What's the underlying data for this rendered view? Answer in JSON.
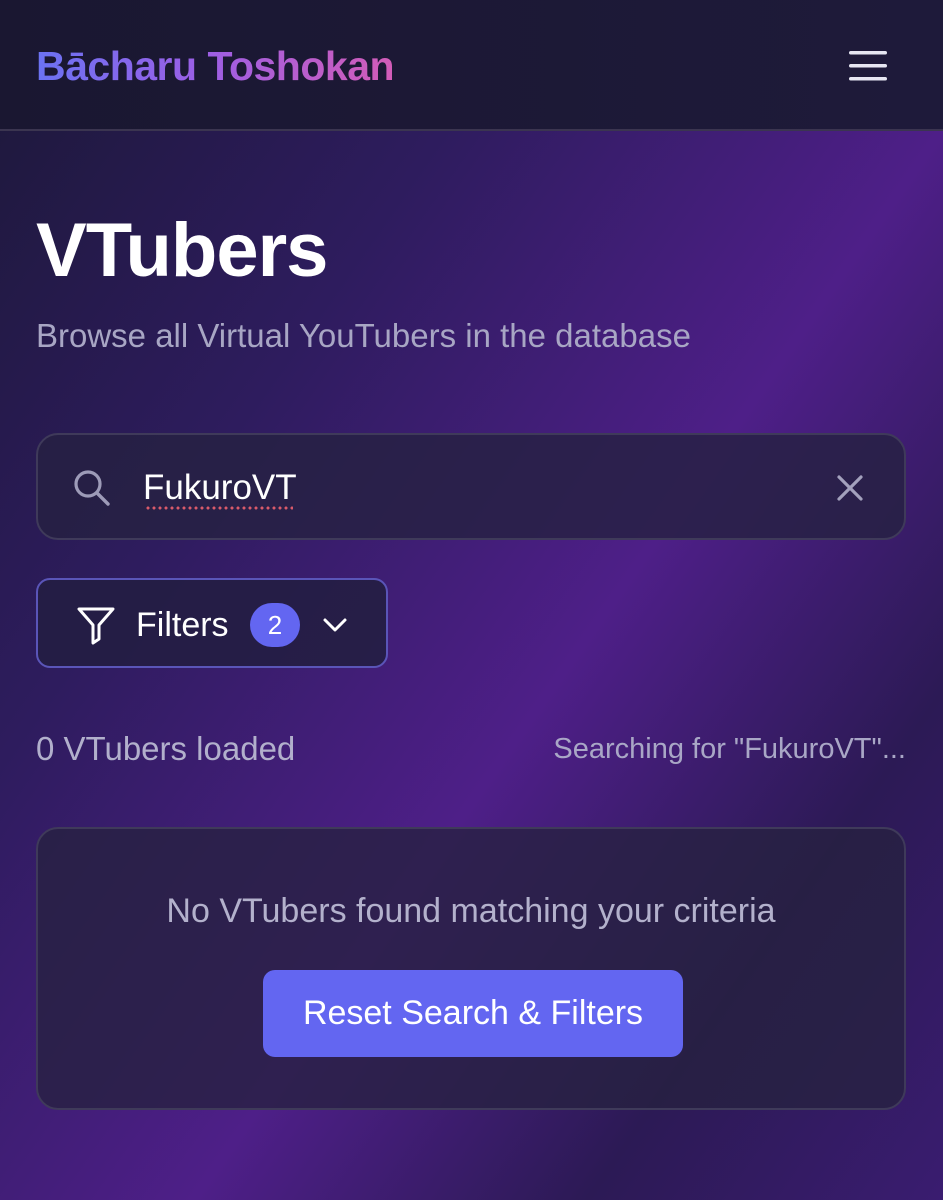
{
  "header": {
    "brand": "Bācharu Toshokan",
    "menu_icon": "hamburger-menu-icon"
  },
  "page": {
    "title": "VTubers",
    "subtitle": "Browse all Virtual YouTubers in the database"
  },
  "search": {
    "value": "FukuroVT",
    "search_icon": "magnifier-icon",
    "clear_icon": "x-close-icon"
  },
  "filters": {
    "label": "Filters",
    "active_count": "2",
    "filter_icon": "funnel-icon",
    "chevron_icon": "chevron-down-icon"
  },
  "results": {
    "count_text": "0 VTubers loaded",
    "status_text": "Searching for \"FukuroVT\"..."
  },
  "empty_state": {
    "message": "No VTubers found matching your criteria",
    "reset_label": "Reset Search & Filters"
  },
  "colors": {
    "accent": "#6366f1",
    "brand_gradient_start": "#6b72f2",
    "brand_gradient_end": "#d35cb8",
    "muted_text": "#a8a6c4",
    "spellcheck": "#d95a6a"
  }
}
